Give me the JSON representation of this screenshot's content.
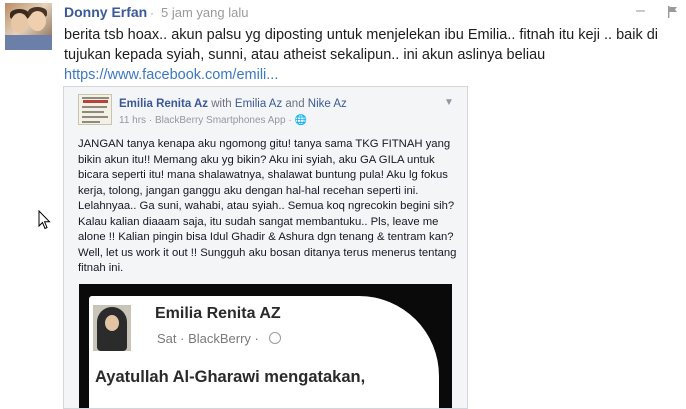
{
  "comment": {
    "author": "Donny Erfan",
    "separator": "·",
    "time": "5 jam yang lalu",
    "minimize": "–",
    "text": "berita tsb hoax.. akun palsu yg diposting untuk menjelekan ibu Emilia.. fitnah itu keji .. baik di tujukan kepada syiah, sunni, atau atheist sekalipun.. ini akun aslinya beliau",
    "link": "https://www.facebook.com/emili..."
  },
  "embedded_post": {
    "poster": "Emilia Renita Az",
    "with_label": "with",
    "with_name_1": "Emilia Az",
    "and_label": "and",
    "with_name_2": "Nike Az",
    "meta": "11 hrs · BlackBerry Smartphones App · 🌐",
    "text": "JANGAN tanya kenapa aku ngomong gitu! tanya sama TKG FITNAH yang bikin akun itu!! Memang aku yg bikin? Aku ini syiah, aku GA GILA untuk bicara seperti itu! mana shalawatnya, shalawat buntung pula! Aku lg fokus kerja, tolong, jangan ganggu aku dengan hal-hal recehan seperti ini. Lelahnyaa.. Ga suni, wahabi, atau syiah.. Semua koq ngrecokin begini sih? Kalau kalian diaaam saja, itu sudah sangat membantuku.. Pls, leave me alone !! Kalian pingin bisa Idul Ghadir & Ashura dgn tenang & tentram kan? Well, let us work it out !! Sungguh aku bosan ditanya terus menerus tentang fitnah ini.",
    "screenshot": {
      "name": "Emilia Renita AZ",
      "meta": "Sat · BlackBerry ·",
      "text": "Ayatullah Al-Gharawi mengatakan,"
    }
  },
  "colors": {
    "link_blue": "#3b5998",
    "url_blue": "#3b78c2",
    "meta_gray": "#9197a3"
  }
}
